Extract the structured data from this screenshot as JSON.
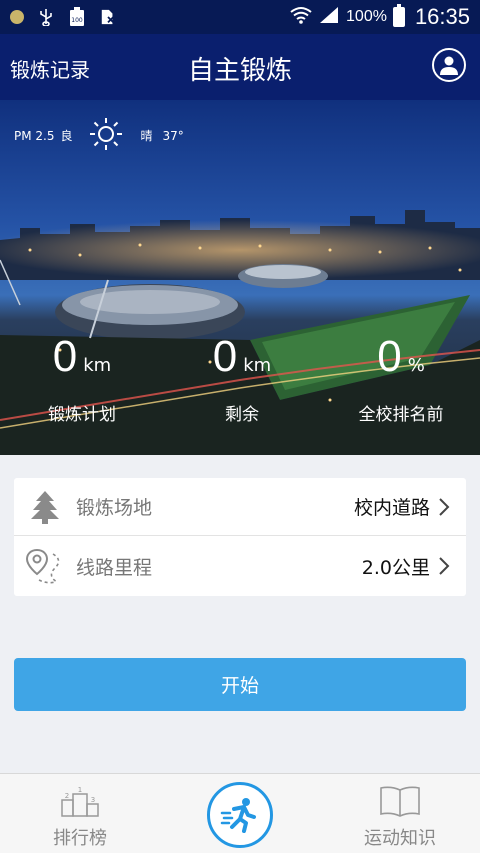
{
  "status_bar": {
    "signal_percent": "100%",
    "time": "16:35",
    "battery_badge": "100"
  },
  "header": {
    "left_link": "锻炼记录",
    "title": "自主锻炼"
  },
  "hero": {
    "weather": {
      "aqi_label": "PM 2.5",
      "aqi_level": "良",
      "condition": "晴",
      "temperature": "37°"
    },
    "stats": [
      {
        "value": "0",
        "unit": "km",
        "label": "锻炼计划"
      },
      {
        "value": "0",
        "unit": "km",
        "label": "剩余"
      },
      {
        "value": "0",
        "unit": "%",
        "label": "全校排名前"
      }
    ]
  },
  "form": {
    "venue_label": "锻炼场地",
    "venue_value": "校内道路",
    "distance_label": "线路里程",
    "distance_value": "2.0公里"
  },
  "start_button": "开始",
  "bottom_nav": {
    "left_label": "排行榜",
    "right_label": "运动知识"
  },
  "colors": {
    "header_bg": "#0a1f6e",
    "accent": "#3fa5e6",
    "nav_active": "#2397e3"
  }
}
